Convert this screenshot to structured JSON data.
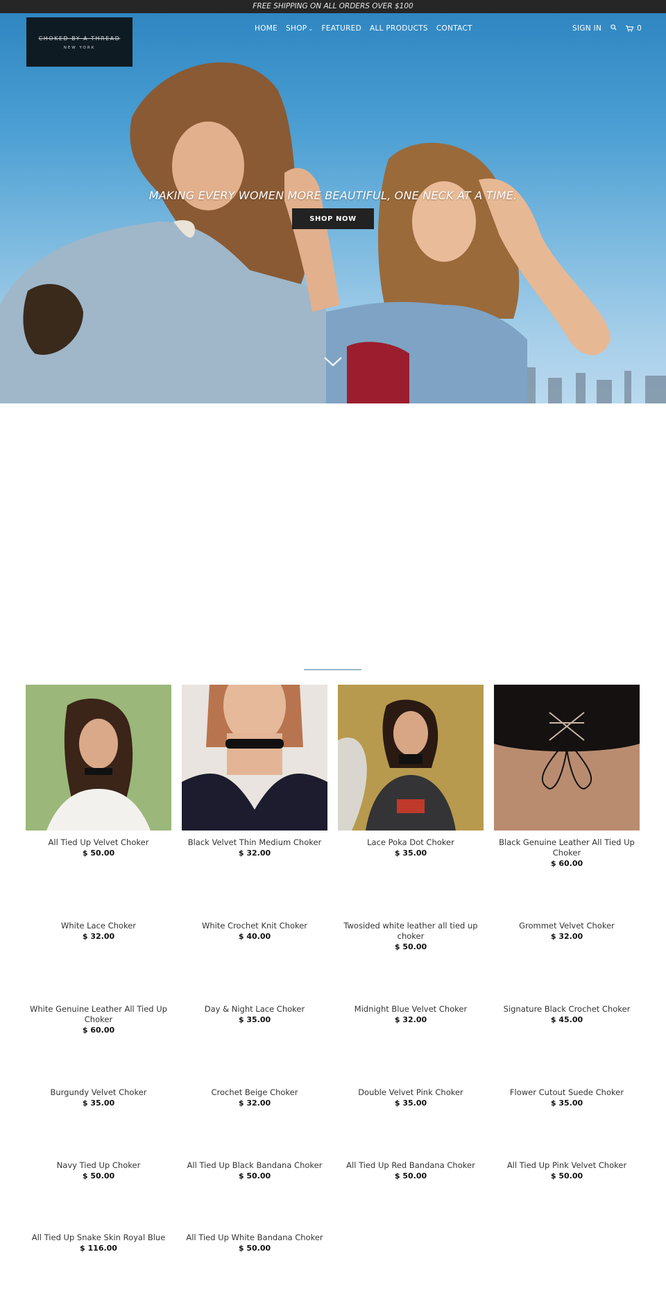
{
  "announcement": "FREE SHIPPING ON ALL ORDERS OVER $100",
  "logo": {
    "line1": "CHOKED BY A THREAD",
    "line2": "NEW YORK"
  },
  "nav": {
    "items": [
      "HOME",
      "SHOP",
      "FEATURED",
      "ALL PRODUCTS",
      "CONTACT"
    ],
    "sign_in": "SIGN IN",
    "cart_count": "0",
    "search_icon": "search-icon",
    "cart_icon": "cart-icon"
  },
  "hero": {
    "tagline": "MAKING EVERY WOMEN MORE BEAUTIFUL, ONE NECK AT A TIME.",
    "button": "SHOP NOW",
    "scroll_icon": "chevron-down-icon"
  },
  "products": [
    {
      "name": "All Tied Up Velvet Choker",
      "price": "$ 50.00"
    },
    {
      "name": "Black Velvet Thin Medium Choker",
      "price": "$ 32.00"
    },
    {
      "name": "Lace Poka Dot Choker",
      "price": "$ 35.00"
    },
    {
      "name": "Black Genuine Leather All Tied Up Choker",
      "price": "$ 60.00"
    },
    {
      "name": "White Lace Choker",
      "price": "$ 32.00"
    },
    {
      "name": "White Crochet Knit Choker",
      "price": "$ 40.00"
    },
    {
      "name": "Twosided white leather all tied up choker",
      "price": "$ 50.00"
    },
    {
      "name": "Grommet Velvet Choker",
      "price": "$ 32.00"
    },
    {
      "name": "White Genuine Leather All Tied Up Choker",
      "price": "$ 60.00"
    },
    {
      "name": "Day & Night Lace Choker",
      "price": "$ 35.00"
    },
    {
      "name": "Midnight Blue Velvet Choker",
      "price": "$ 32.00"
    },
    {
      "name": "Signature Black Crochet Choker",
      "price": "$ 45.00"
    },
    {
      "name": "Burgundy Velvet Choker",
      "price": "$ 35.00"
    },
    {
      "name": "Crochet Beige Choker",
      "price": "$ 32.00"
    },
    {
      "name": "Double Velvet Pink Choker",
      "price": "$ 35.00"
    },
    {
      "name": "Flower Cutout Suede Choker",
      "price": "$ 35.00"
    },
    {
      "name": "Navy Tied Up Choker",
      "price": "$ 50.00"
    },
    {
      "name": "All Tied Up Black Bandana Choker",
      "price": "$ 50.00"
    },
    {
      "name": "All Tied Up Red Bandana Choker",
      "price": "$ 50.00"
    },
    {
      "name": "All Tied Up Pink Velvet Choker",
      "price": "$ 50.00"
    },
    {
      "name": "All Tied Up Snake Skin Royal Blue",
      "price": "$ 116.00"
    },
    {
      "name": "All Tied Up White Bandana Choker",
      "price": "$ 50.00"
    }
  ],
  "colors": {
    "topbar": "#262626",
    "button": "#222222",
    "accent_rule": "#4a7fa8"
  }
}
